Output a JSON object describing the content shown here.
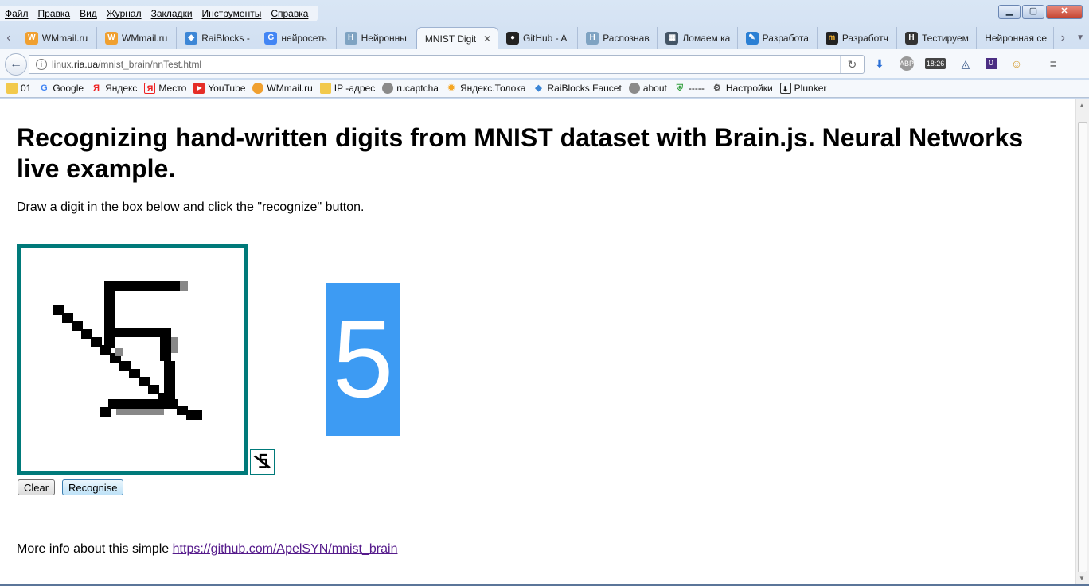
{
  "menu": [
    "Файл",
    "Правка",
    "Вид",
    "Журнал",
    "Закладки",
    "Инструменты",
    "Справка"
  ],
  "tabs": [
    {
      "title": "WMmail.ru",
      "icon": "wmmail-icon",
      "color": "#f0a030"
    },
    {
      "title": "WMmail.ru",
      "icon": "wmmail-icon",
      "color": "#f0a030"
    },
    {
      "title": "RaiBlocks -",
      "icon": "raiblocks-icon",
      "color": "#3c86d6"
    },
    {
      "title": "нейросеть",
      "icon": "google-icon",
      "color": "#4285f4"
    },
    {
      "title": "Нейронны",
      "icon": "habr-icon",
      "color": "#7fa3c2"
    },
    {
      "title": "MNIST Digit",
      "icon": "",
      "color": "",
      "active": true
    },
    {
      "title": "GitHub - A",
      "icon": "github-icon",
      "color": "#222222"
    },
    {
      "title": "Распознав",
      "icon": "habr-icon",
      "color": "#7fa3c2"
    },
    {
      "title": "Ломаем ка",
      "icon": "grid-icon",
      "color": "#445566"
    },
    {
      "title": "Разработа",
      "icon": "pencil-icon",
      "color": "#2a7fd4"
    },
    {
      "title": "Разработч",
      "icon": "m-icon",
      "color": "#222222"
    },
    {
      "title": "Тестируем",
      "icon": "h-icon",
      "color": "#333333"
    },
    {
      "title": "Нейронная се",
      "icon": "",
      "color": ""
    }
  ],
  "tab_close": "✕",
  "url": {
    "pre": "linux.",
    "domain": "ria.ua",
    "path": "/mnist_brain/nnTest.html"
  },
  "clock": "18:26",
  "badge": "0",
  "bookmarks": [
    {
      "label": "01",
      "icon": "folder-icon"
    },
    {
      "label": "Google",
      "icon": "google-icon"
    },
    {
      "label": "Яндекс",
      "icon": "yandex-icon"
    },
    {
      "label": "Место",
      "icon": "yandex-place-icon"
    },
    {
      "label": "YouTube",
      "icon": "youtube-icon"
    },
    {
      "label": "WMmail.ru",
      "icon": "wmmail-icon"
    },
    {
      "label": "IP -адрес",
      "icon": "folder-icon"
    },
    {
      "label": "rucaptcha",
      "icon": "globe-icon"
    },
    {
      "label": "Яндекс.Толока",
      "icon": "toloka-icon"
    },
    {
      "label": "RaiBlocks Faucet",
      "icon": "raiblocks-icon"
    },
    {
      "label": "about",
      "icon": "globe-icon"
    },
    {
      "label": "-----",
      "icon": "shield-icon"
    },
    {
      "label": "Настройки",
      "icon": "gear-icon"
    },
    {
      "label": "Plunker",
      "icon": "download-icon"
    }
  ],
  "page": {
    "title": "Recognizing hand-written digits from MNIST dataset with Brain.js. Neural Networks live example.",
    "intro": "Draw a digit in the box below and click the \"recognize\" button.",
    "result": "5",
    "clear_label": "Clear",
    "recognise_label": "Recognise",
    "more_info": "More info about this simple",
    "link": "https://github.com/ApelSYN/mnist_brain"
  },
  "colors": {
    "canvas_border": "#007a7a",
    "result_bg": "#3d9bf3",
    "link": "#551a8b"
  }
}
